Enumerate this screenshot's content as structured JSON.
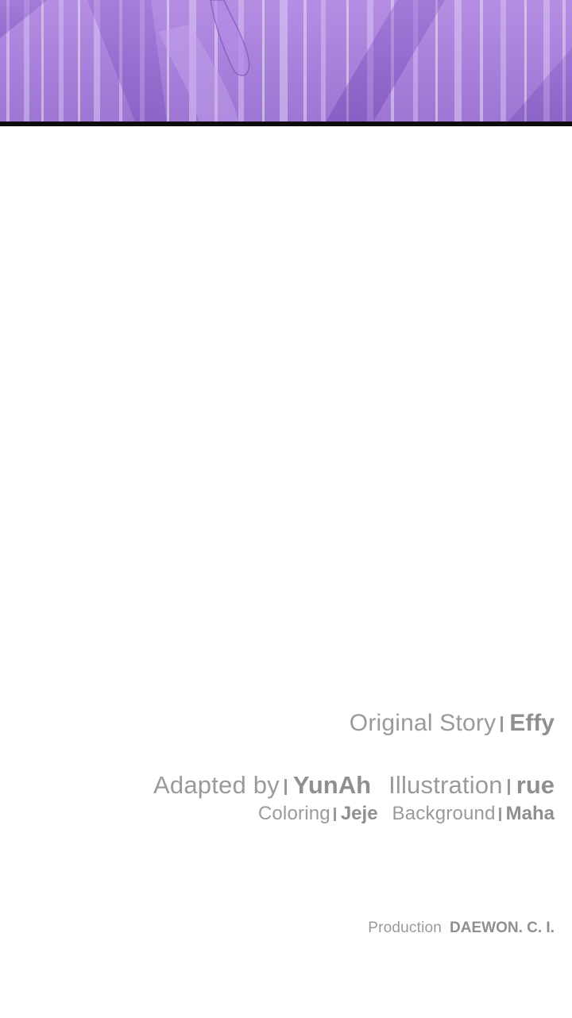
{
  "panel": {
    "description_icon": "purple-curtain-artwork"
  },
  "credits": {
    "original_story": {
      "label": "Original Story",
      "name": "Effy"
    },
    "adapted_by": {
      "label": "Adapted by",
      "name": "YunAh"
    },
    "illustration": {
      "label": "Illustration",
      "name": "rue"
    },
    "coloring": {
      "label": "Coloring",
      "name": "Jeje"
    },
    "background": {
      "label": "Background",
      "name": "Maha"
    },
    "production": {
      "label": "Production",
      "name": "DAEWON. C. I."
    }
  },
  "colors": {
    "panel_purple": "#a57fd9",
    "border": "#0d0d0d",
    "credit_text": "#9a9a9a"
  }
}
